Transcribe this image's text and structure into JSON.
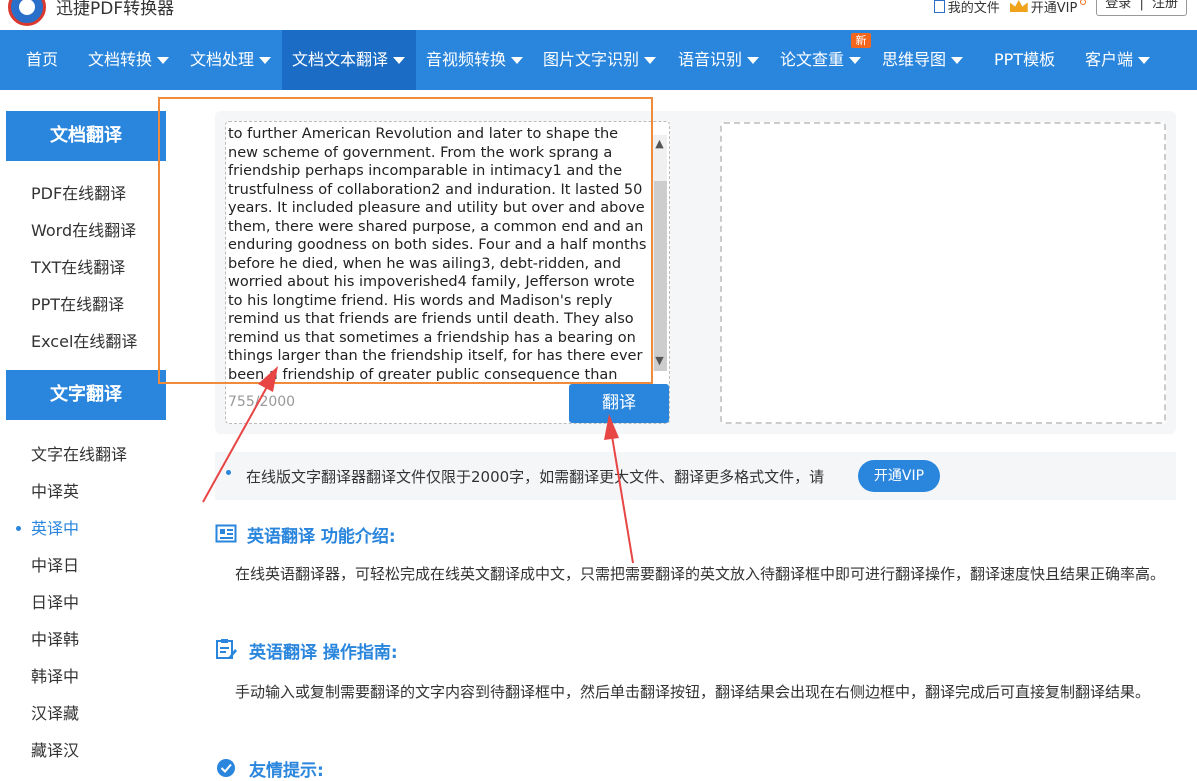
{
  "header": {
    "brand": "迅捷PDF转换器",
    "my_files": "我的文件",
    "vip": "开通VIP",
    "login": "登录",
    "separator": "|",
    "register": "注册"
  },
  "nav": {
    "items": [
      {
        "label": "首页"
      },
      {
        "label": "文档转换"
      },
      {
        "label": "文档处理"
      },
      {
        "label": "文档文本翻译"
      },
      {
        "label": "音视频转换"
      },
      {
        "label": "图片文字识别"
      },
      {
        "label": "语音识别"
      },
      {
        "label": "论文查重"
      },
      {
        "label": "思维导图"
      },
      {
        "label": "PPT模板"
      },
      {
        "label": "客户端"
      }
    ],
    "new_badge": "新"
  },
  "sidebar": {
    "doc_title": "文档翻译",
    "doc_items": [
      "PDF在线翻译",
      "Word在线翻译",
      "TXT在线翻译",
      "PPT在线翻译",
      "Excel在线翻译"
    ],
    "text_title": "文字翻译",
    "text_items": [
      "文字在线翻译",
      "中译英",
      "英译中",
      "中译日",
      "日译中",
      "中译韩",
      "韩译中",
      "汉译藏",
      "藏译汉"
    ]
  },
  "translator": {
    "source_text": "to further American Revolution and later to shape the new scheme of government. From the work sprang a friendship perhaps incomparable in intimacy1 and the trustfulness of collaboration2 and induration. It lasted 50 years. It included pleasure and utility but over and above them, there were shared purpose, a common end and an enduring goodness on both sides. Four and a half months before he died, when he was ailing3, debt-ridden, and worried about his impoverished4 family, Jefferson wrote to his longtime friend. His words and Madison's reply remind us that friends are friends until death. They also remind us that sometimes a friendship has a bearing on things larger than the friendship itself, for has there ever been a friendship of greater public consequence than this one?",
    "counter": "755/2000",
    "button": "翻译"
  },
  "notice": {
    "text": "在线版文字翻译器翻译文件仅限于2000字，如需翻译更大文件、翻译更多格式文件，请",
    "button": "开通VIP"
  },
  "sections": [
    {
      "title": "英语翻译 功能介绍:",
      "body": "在线英语翻译器，可轻松完成在线英文翻译成中文，只需把需要翻译的英文放入待翻译框中即可进行翻译操作，翻译速度快且结果正确率高。"
    },
    {
      "title": "英语翻译 操作指南:",
      "body": "手动输入或复制需要翻译的文字内容到待翻译框中，然后单击翻译按钮，翻译结果会出现在右侧边框中，翻译完成后可直接复制翻译结果。"
    },
    {
      "title": "友情提示:"
    }
  ],
  "colors": {
    "primary": "#2a86dd",
    "nav_active": "#1a6cc4",
    "annotation": "#e84545",
    "highlight_box": "#f08a3c",
    "badge": "#f2661d"
  }
}
